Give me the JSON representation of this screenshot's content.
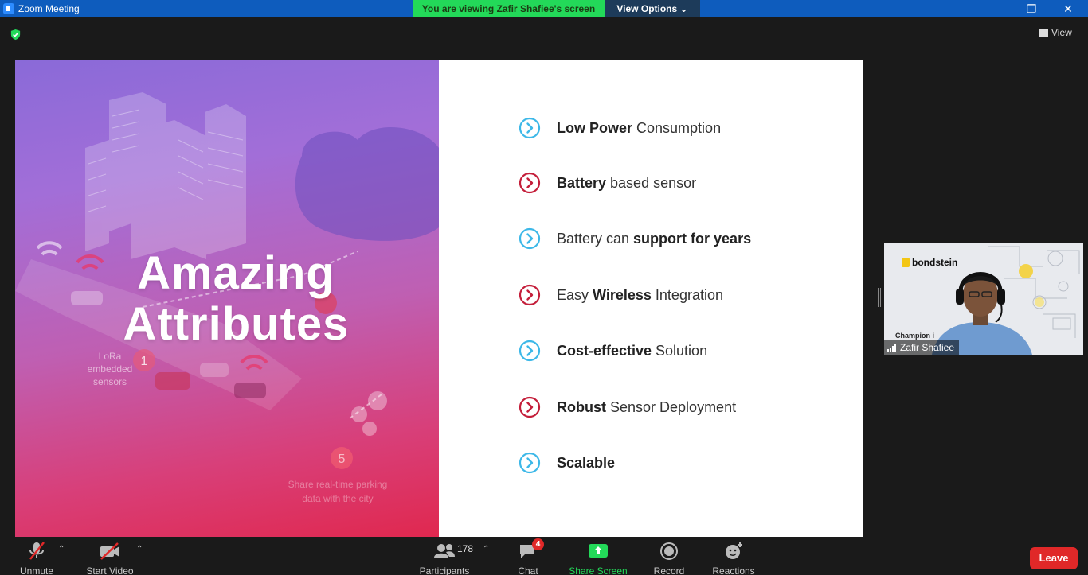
{
  "window": {
    "title": "Zoom Meeting",
    "banner": "You are viewing Zafir Shafiee's screen",
    "view_options": "View Options",
    "minimize_icon": "minimize-icon",
    "restore_icon": "restore-icon",
    "close_icon": "close-icon"
  },
  "top": {
    "view_label": "View",
    "security_color": "#23d959"
  },
  "slide": {
    "title_line1": "Amazing",
    "title_line2": "Attributes",
    "lora_label": "LoRa embedded sensors",
    "lora_step": "1",
    "share_step": "5",
    "share_label": "Share real-time parking data with the city",
    "attributes": [
      {
        "bold_first": true,
        "bold": "Low Power",
        "rest": " Consumption",
        "color": "#3db8e8"
      },
      {
        "bold_first": true,
        "bold": "Battery",
        "rest": " based sensor",
        "color": "#c41e3a"
      },
      {
        "bold_first": false,
        "pre": "Battery can ",
        "bold": "support for years",
        "color": "#3db8e8"
      },
      {
        "bold_first": false,
        "pre": "Easy ",
        "bold": "Wireless",
        "rest": " Integration",
        "color": "#c41e3a"
      },
      {
        "bold_first": true,
        "bold": "Cost-effective",
        "rest": " Solution",
        "color": "#3db8e8"
      },
      {
        "bold_first": true,
        "bold": "Robust",
        "rest": " Sensor Deployment",
        "color": "#c41e3a"
      },
      {
        "bold_first": true,
        "bold": "Scalable",
        "rest": "",
        "color": "#3db8e8"
      }
    ]
  },
  "participant": {
    "name": "Zafir Shafiee",
    "logo_text": "bondstein",
    "champion_text": "Champion i"
  },
  "toolbar": {
    "unmute": "Unmute",
    "start_video": "Start Video",
    "participants": "Participants",
    "participant_count": "178",
    "chat": "Chat",
    "chat_badge": "4",
    "share_screen": "Share Screen",
    "record": "Record",
    "reactions": "Reactions",
    "leave": "Leave"
  }
}
